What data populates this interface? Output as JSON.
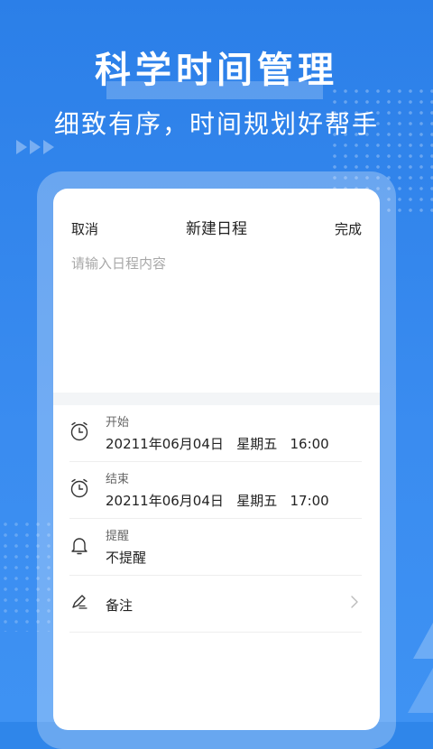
{
  "promo": {
    "headline": "科学时间管理",
    "subline": "细致有序，时间规划好帮手"
  },
  "form": {
    "cancel_label": "取消",
    "title": "新建日程",
    "done_label": "完成",
    "content_placeholder": "请输入日程内容",
    "content_value": ""
  },
  "rows": {
    "start": {
      "label": "开始",
      "value": "20211年06月04日   星期五   16:00",
      "icon": "clock-icon"
    },
    "end": {
      "label": "结束",
      "value": "20211年06月04日   星期五   17:00",
      "icon": "clock-icon"
    },
    "reminder": {
      "label": "提醒",
      "value": "不提醒",
      "icon": "bell-icon"
    },
    "note": {
      "value": "备注",
      "icon": "pen-icon"
    }
  },
  "colors": {
    "background": "#2f86ea",
    "card": "#ffffff",
    "text_primary": "#222222",
    "text_placeholder": "#a8a8a8"
  }
}
